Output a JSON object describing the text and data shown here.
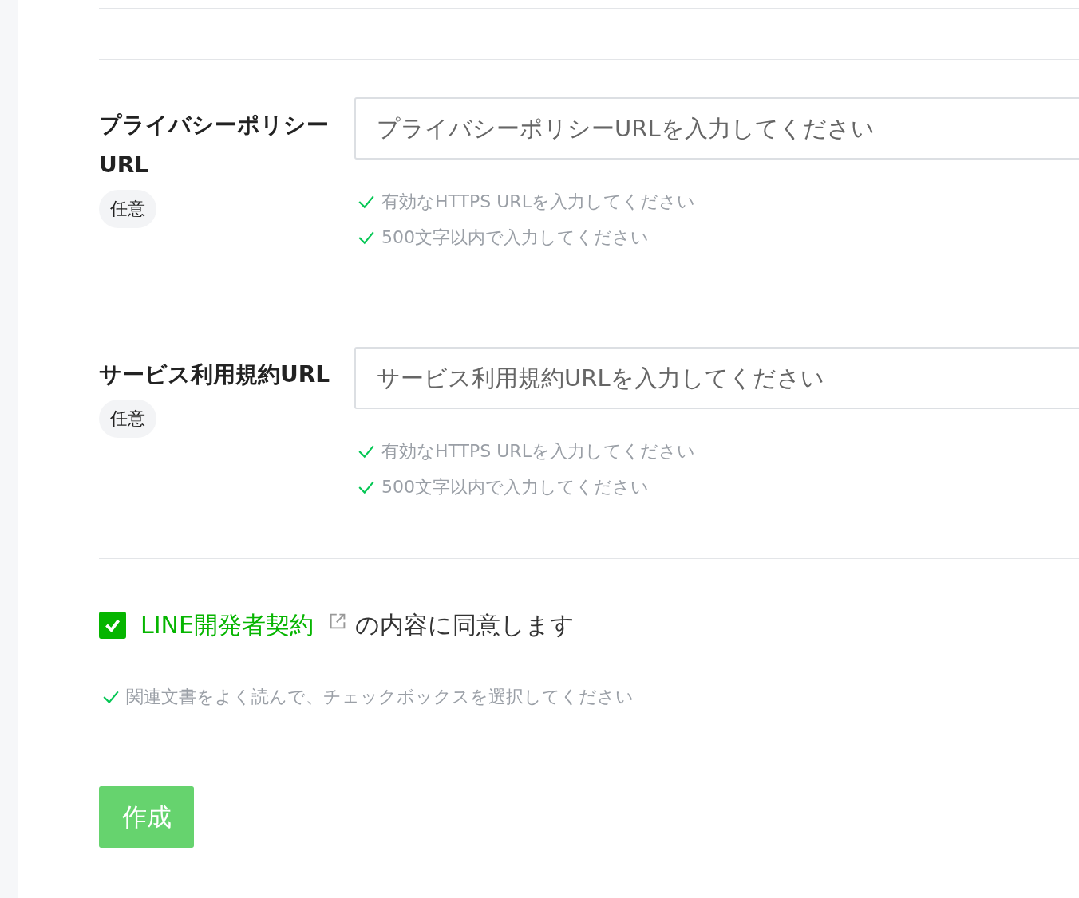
{
  "fields": [
    {
      "label": "プライバシーポリシーURL",
      "badge": "任意",
      "placeholder": "プライバシーポリシーURLを入力してください",
      "rules": [
        {
          "text": "有効なHTTPS URLを入力してください",
          "met": true
        },
        {
          "text": "500文字以内で入力してください",
          "met": true
        }
      ]
    },
    {
      "label": "サービス利用規約URL",
      "badge": "任意",
      "placeholder": "サービス利用規約URLを入力してください",
      "rules": [
        {
          "text": "有効なHTTPS URLを入力してください",
          "met": true
        },
        {
          "text": "500文字以内で入力してください",
          "met": true
        }
      ]
    }
  ],
  "agreement": {
    "checked": true,
    "link": "LINE開発者契約",
    "text": "の内容に同意します",
    "hint": {
      "text": "関連文書をよく読んで、チェックボックスを選択してください",
      "met": true
    }
  },
  "submit": "作成"
}
